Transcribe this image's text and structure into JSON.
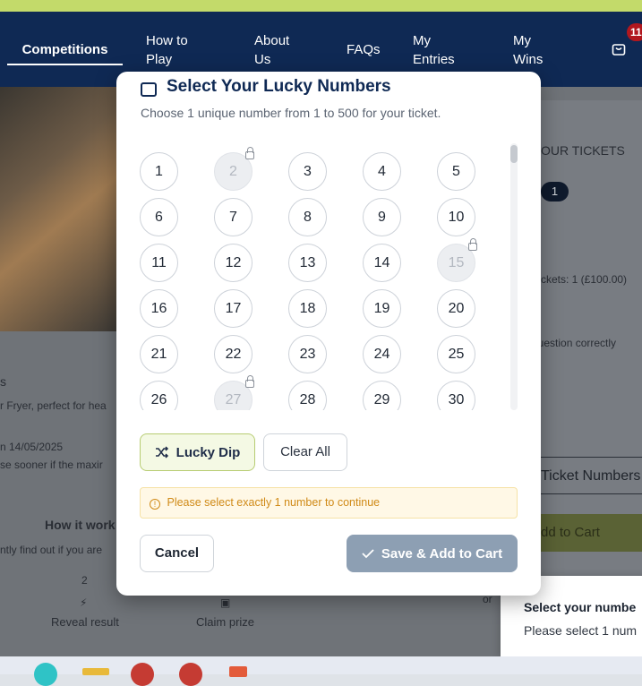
{
  "nav": {
    "items": [
      "Competitions",
      "How to\nPlay",
      "About\nUs",
      "FAQs",
      "My\nEntries",
      "My\nWins"
    ],
    "cart_count": "11"
  },
  "background": {
    "your_tickets_heading": "OUR TICKETS",
    "ticket_pill": "1",
    "tickets_summary": "ckets: 1 (£100.00)",
    "question_note": "question correctly",
    "product_title": "s",
    "product_desc": "r Fryer, perfect for hea",
    "draw_date": "n 14/05/2025",
    "draw_note": "se sooner if the maxir",
    "how_it_works": "How it work",
    "how_it_works_sub": "ntly find out if you are",
    "step_number": "2",
    "step_reveal": "Reveal result",
    "step_claim": "Claim prize",
    "or_text": "or",
    "ticket_numbers_button": "Ticket Numbers",
    "add_to_cart_button": "dd to Cart"
  },
  "toast": {
    "title": "Select your numbe",
    "body": "Please select 1 num"
  },
  "modal": {
    "title": "Select Your Lucky Numbers",
    "subtitle": "Choose 1 unique number from 1 to 500 for your ticket.",
    "numbers": [
      "1",
      "2",
      "3",
      "4",
      "5",
      "6",
      "7",
      "8",
      "9",
      "10",
      "11",
      "12",
      "13",
      "14",
      "15",
      "16",
      "17",
      "18",
      "19",
      "20",
      "21",
      "22",
      "23",
      "24",
      "25",
      "26",
      "27",
      "28",
      "29",
      "30"
    ],
    "taken_numbers": [
      "2",
      "15",
      "27"
    ],
    "lucky_dip_label": "Lucky Dip",
    "clear_all_label": "Clear All",
    "warning_text": "Please select exactly 1 number to continue",
    "cancel_label": "Cancel",
    "save_label": "Save & Add to Cart"
  },
  "colors": {
    "nav_bg": "#0f2954",
    "accent_green": "#c3da6a",
    "badge_red": "#b1171e",
    "warning": "#d08a17"
  }
}
